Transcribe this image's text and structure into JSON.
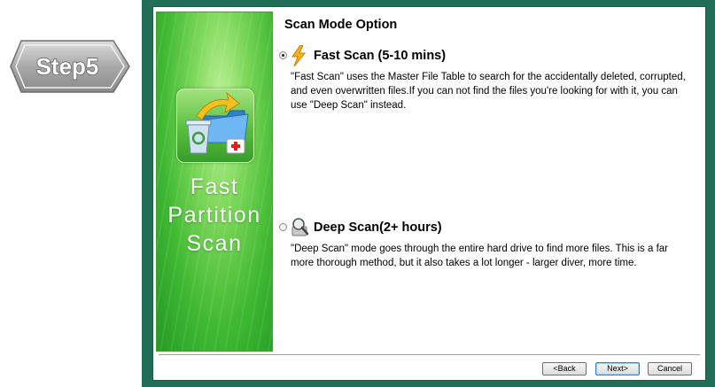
{
  "step_badge": {
    "label": "Step5"
  },
  "banner": {
    "title_lines": [
      "Fast",
      "Partition",
      "Scan"
    ],
    "icon": "recycle-bin-folder-firstaid-icon"
  },
  "content": {
    "heading": "Scan Mode Option",
    "options": [
      {
        "label": "Fast Scan (5-10 mins)",
        "selected": true,
        "icon": "lightning-bolt-icon",
        "description": "\"Fast Scan\" uses the Master File Table to search for the accidentally deleted, corrupted, and even overwritten files.If you can not find the files you're looking for with it, you can use \"Deep Scan\" instead."
      },
      {
        "label": "Deep Scan(2+ hours)",
        "selected": false,
        "icon": "magnifier-drive-icon",
        "description": "\"Deep Scan\" mode goes through the entire hard drive to find more files. This is a far more thorough method, but it also takes a lot longer - larger diver, more time."
      }
    ]
  },
  "buttons": {
    "back": "<Back",
    "next": "Next>",
    "cancel": "Cancel"
  },
  "colors": {
    "frame": "#216d55",
    "banner_green": "#3fb832"
  }
}
